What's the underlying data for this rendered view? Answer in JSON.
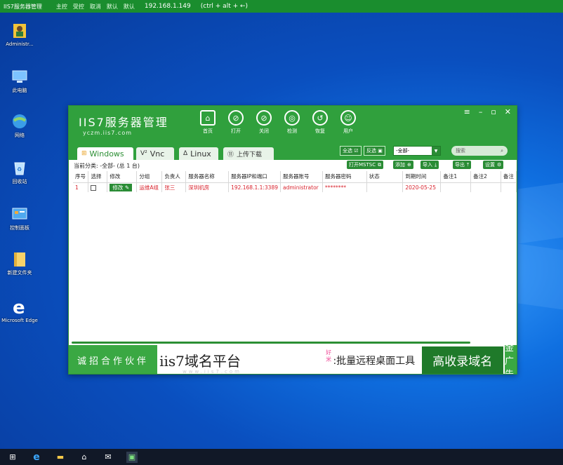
{
  "topbar": {
    "title": "IIS7服务器管理",
    "items": [
      "主控",
      "受控",
      "取消",
      "默认",
      "默认"
    ],
    "ip": "192.168.1.149",
    "hotkey": "(ctrl + alt + ←)"
  },
  "desktop": {
    "icons": [
      {
        "label": "Administr...",
        "icon": "user-folder-icon"
      },
      {
        "label": "此电脑",
        "icon": "this-pc-icon"
      },
      {
        "label": "网络",
        "icon": "network-icon"
      },
      {
        "label": "回收站",
        "icon": "recycle-bin-icon"
      },
      {
        "label": "控制面板",
        "icon": "control-panel-icon"
      },
      {
        "label": "新建文件夹",
        "icon": "folder-icon"
      },
      {
        "label": "Microsoft Edge",
        "icon": "edge-icon"
      }
    ]
  },
  "app": {
    "logo_title": "IIS7服务器管理",
    "logo_sub": "yczm.iis7.com",
    "tools": [
      {
        "label": "首页",
        "glyph": "⌂"
      },
      {
        "label": "打开",
        "glyph": "⊘"
      },
      {
        "label": "关闭",
        "glyph": "⊘"
      },
      {
        "label": "检测",
        "glyph": "◎"
      },
      {
        "label": "恢复",
        "glyph": "↺"
      },
      {
        "label": "用户",
        "glyph": "☺"
      }
    ],
    "tabs": [
      {
        "label": "Windows",
        "glyph": "⊞"
      },
      {
        "label": "Vnc",
        "glyph": "V²"
      },
      {
        "label": "Linux",
        "glyph": "Δ"
      },
      {
        "label": "上传下载",
        "glyph": "⑪"
      }
    ],
    "select_all": "全选",
    "invert_select": "反选",
    "group_select": "-全部-",
    "search_placeholder": "搜索",
    "crumb": "当前分类:  -全部- (总 1 台)",
    "actions": {
      "mstsc": "打开MSTSC",
      "add": "添加",
      "import": "导入",
      "export": "导出",
      "settings": "设置"
    },
    "table": {
      "headers": [
        "序号",
        "选择",
        "修改",
        "分组",
        "负责人",
        "服务器名称",
        "服务器IP和端口",
        "服务器账号",
        "服务器密码",
        "状态",
        "到期时间",
        "备注1",
        "备注2",
        "备注"
      ],
      "rows": [
        {
          "index": "1",
          "edit": "修改",
          "group": "运维A组",
          "owner": "张三",
          "name": "深圳机房",
          "ip": "192.168.1.1:3389",
          "account": "administrator",
          "password": "********",
          "status": "",
          "expire": "2020-05-25",
          "note1": "",
          "note2": "",
          "note3": ""
        }
      ]
    },
    "ads": {
      "a1": "诚招合作伙伴",
      "a2_big": "iis7域名平台",
      "a2_small": "www.iis7.com",
      "a2_side": "好米",
      "a2b": ":批量远程桌面工具",
      "a3": "高收录域名",
      "a4": "黄金广告位"
    }
  }
}
